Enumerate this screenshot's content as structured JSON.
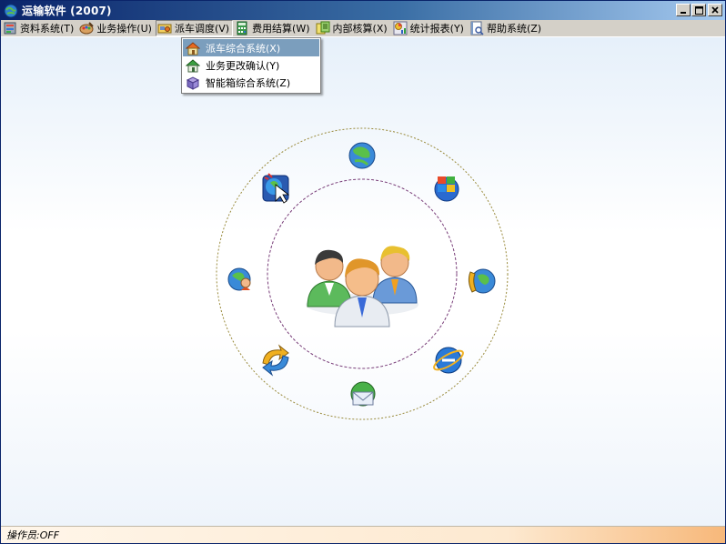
{
  "window": {
    "title": "运输软件 (2007)"
  },
  "menubar": {
    "items": [
      {
        "label": "资料系统(T)",
        "icon": "database-icon"
      },
      {
        "label": "业务操作(U)",
        "icon": "palette-icon"
      },
      {
        "label": "派车调度(V)",
        "icon": "truck-icon",
        "active": true
      },
      {
        "label": "费用结算(W)",
        "icon": "calculator-icon"
      },
      {
        "label": "内部核算(X)",
        "icon": "ledger-icon"
      },
      {
        "label": "统计报表(Y)",
        "icon": "report-icon"
      },
      {
        "label": "帮助系统(Z)",
        "icon": "help-book-icon"
      }
    ]
  },
  "dropdown": {
    "items": [
      {
        "label": "派车综合系统(X)",
        "icon": "home-icon",
        "highlighted": true
      },
      {
        "label": "业务更改确认(Y)",
        "icon": "home-green-icon"
      },
      {
        "label": "智能箱综合系统(Z)",
        "icon": "box-icon"
      }
    ]
  },
  "orbit": {
    "center_icon": "users-group-icon",
    "satellites": [
      "globe-icon",
      "windows-logo-icon",
      "globe-phone-icon",
      "internet-explorer-icon",
      "mail-globe-icon",
      "refresh-arrows-icon",
      "network-user-icon",
      "cursor-globe-icon"
    ]
  },
  "status": {
    "text": "操作员:OFF"
  },
  "colors": {
    "titlebar": "#0a246a",
    "highlight": "#7b9ebd",
    "outer_ring": "#9a8b3c",
    "inner_ring": "#7a3f7a"
  }
}
